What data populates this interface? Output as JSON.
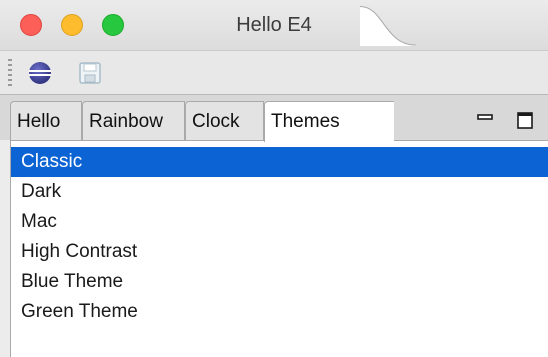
{
  "window": {
    "title": "Hello E4"
  },
  "toolbar": {
    "items": [
      {
        "icon": "eclipse-icon"
      },
      {
        "icon": "save-icon",
        "state": "disabled"
      }
    ]
  },
  "tabs": [
    {
      "label": "Hello",
      "active": false
    },
    {
      "label": "Rainbow",
      "active": false
    },
    {
      "label": "Clock",
      "active": false
    },
    {
      "label": "Themes",
      "active": true
    }
  ],
  "view_controls": [
    {
      "icon": "minimize-icon"
    },
    {
      "icon": "maximize-icon"
    }
  ],
  "themes_list": {
    "selected": "Classic",
    "items": [
      "Classic",
      "Dark",
      "Mac",
      "High Contrast",
      "Blue Theme",
      "Green Theme"
    ]
  },
  "colors": {
    "selection": "#0b63d4",
    "close": "#fc5f57",
    "minimize": "#fdbc2e",
    "maximize": "#27c840"
  }
}
